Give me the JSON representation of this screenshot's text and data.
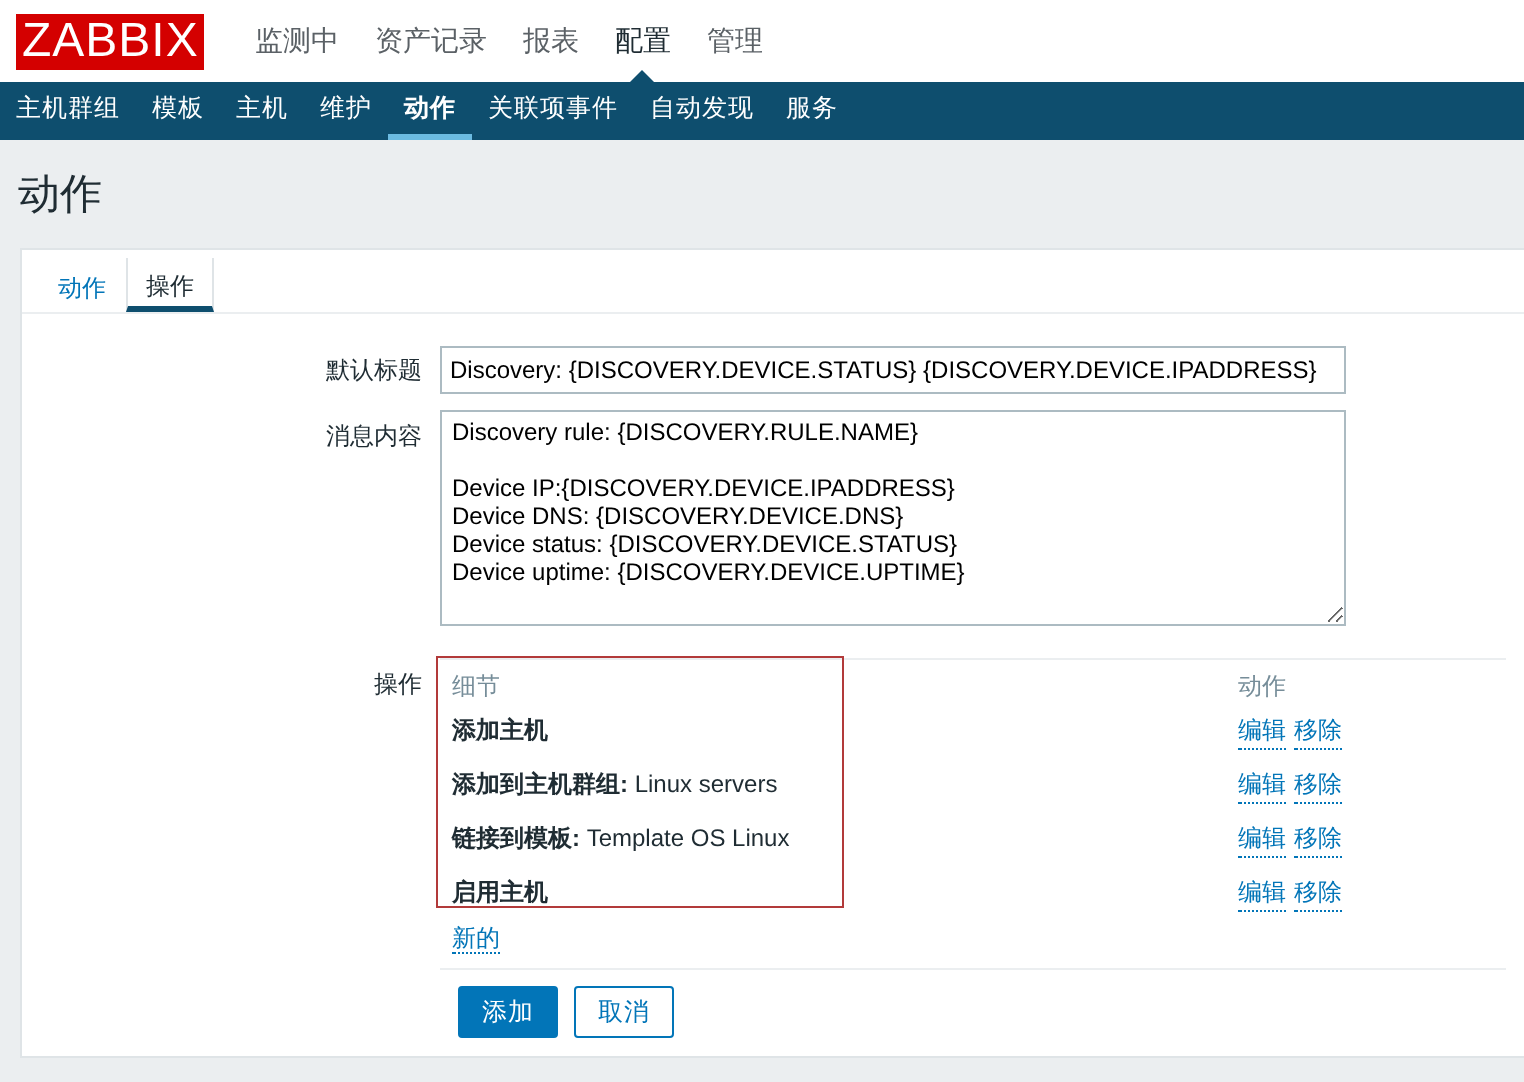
{
  "logo": "ZABBIX",
  "main_menu": [
    {
      "label": "监测中",
      "selected": false
    },
    {
      "label": "资产记录",
      "selected": false
    },
    {
      "label": "报表",
      "selected": false
    },
    {
      "label": "配置",
      "selected": true
    },
    {
      "label": "管理",
      "selected": false
    }
  ],
  "sub_menu": [
    {
      "label": "主机群组",
      "selected": false
    },
    {
      "label": "模板",
      "selected": false
    },
    {
      "label": "主机",
      "selected": false
    },
    {
      "label": "维护",
      "selected": false
    },
    {
      "label": "动作",
      "selected": true
    },
    {
      "label": "关联项事件",
      "selected": false
    },
    {
      "label": "自动发现",
      "selected": false
    },
    {
      "label": "服务",
      "selected": false
    }
  ],
  "page_title": "动作",
  "tabs": [
    {
      "label": "动作",
      "selected": false
    },
    {
      "label": "操作",
      "selected": true
    }
  ],
  "form": {
    "default_subject": {
      "label": "默认标题",
      "value": "Discovery: {DISCOVERY.DEVICE.STATUS} {DISCOVERY.DEVICE.IPADDRESS}"
    },
    "message": {
      "label": "消息内容",
      "value": "Discovery rule: {DISCOVERY.RULE.NAME}\n\nDevice IP:{DISCOVERY.DEVICE.IPADDRESS}\nDevice DNS: {DISCOVERY.DEVICE.DNS}\nDevice status: {DISCOVERY.DEVICE.STATUS}\nDevice uptime: {DISCOVERY.DEVICE.UPTIME}"
    },
    "operations": {
      "label": "操作",
      "columns": [
        "细节",
        "动作"
      ],
      "rows": [
        {
          "details": "**添加主机**",
          "edit": "编辑",
          "remove": "移除"
        },
        {
          "details": "**添加到主机群组:** Linux servers",
          "edit": "编辑",
          "remove": "移除"
        },
        {
          "details": "**链接到模板:** Template OS Linux",
          "edit": "编辑",
          "remove": "移除"
        },
        {
          "details": "**启用主机**",
          "edit": "编辑",
          "remove": "移除"
        }
      ],
      "new_link": "新的"
    }
  },
  "buttons": [
    {
      "label": "添加",
      "kind": "primary"
    },
    {
      "label": "取消",
      "kind": "secondary"
    }
  ]
}
